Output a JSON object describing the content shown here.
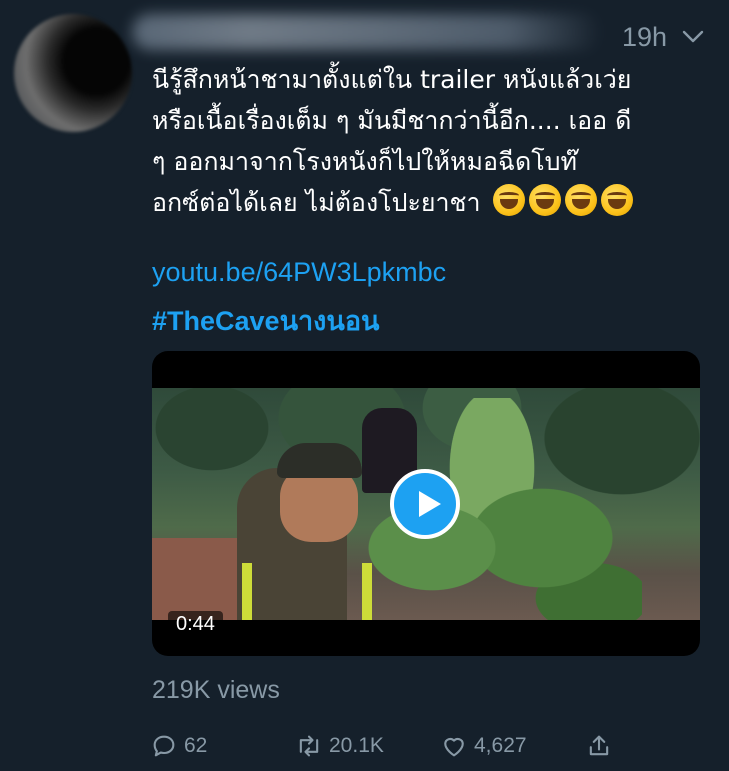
{
  "tweet": {
    "timestamp": "19h",
    "text_lines": [
      "นีรู้สึกหน้าชามาตั้งแต่ใน trailer หนังแล้วเว่ย",
      "หรือเนื้อเรื่องเต็ม ๆ มันมีชากว่านี้อีก.... เออ ดี",
      "ๆ ออกมาจากโรงหนังก็ไปให้หมอฉีดโบท๊",
      "อกซ์ต่อได้เลย ไม่ต้องโปะยาชา"
    ],
    "emoji_count": 4,
    "emoji_name": "rolling-on-the-floor-laughing",
    "link": "youtu.be/64PW3Lpkmbc",
    "hashtag": "#TheCaveนางนอน"
  },
  "video": {
    "duration": "0:44",
    "accent_color": "#1da1f2"
  },
  "views": "219K views",
  "actions": {
    "reply_count": "62",
    "retweet_count": "20.1K",
    "like_count": "4,627"
  },
  "icons": {
    "reply": "reply-icon",
    "retweet": "retweet-icon",
    "like": "heart-icon",
    "share": "share-icon",
    "menu": "chevron-down-icon",
    "play": "play-icon"
  },
  "colors": {
    "background": "#15202b",
    "secondary_text": "#8899a6",
    "link": "#1da1f2"
  }
}
